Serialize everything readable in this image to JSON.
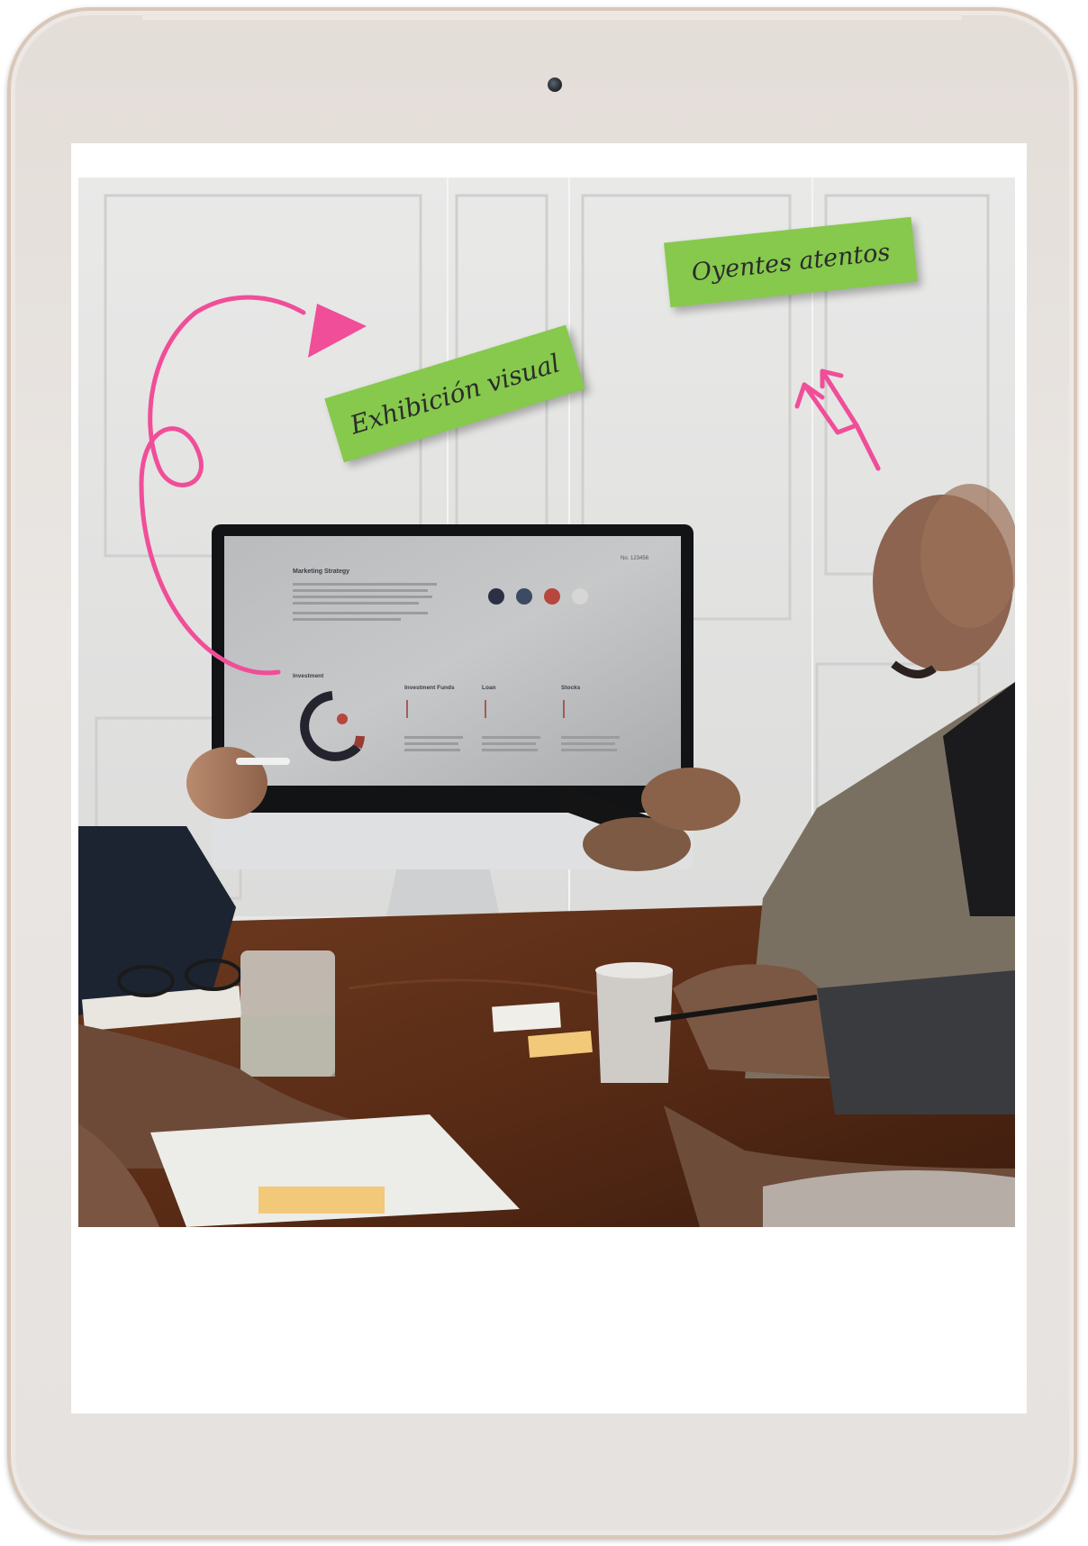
{
  "annotations": {
    "visual_label": "Exhibición visual",
    "listeners_label": "Oyentes atentos"
  },
  "monitor": {
    "ref_number": "No. 123456",
    "title": "Marketing Strategy",
    "section_investment": "Investment",
    "section_funds": "Investment Funds",
    "section_loan": "Loan",
    "section_stocks": "Stocks"
  },
  "colors": {
    "sticky_note": "#86c94d",
    "arrow": "#f04e98",
    "tablet_frame": "#e7e3e0"
  }
}
